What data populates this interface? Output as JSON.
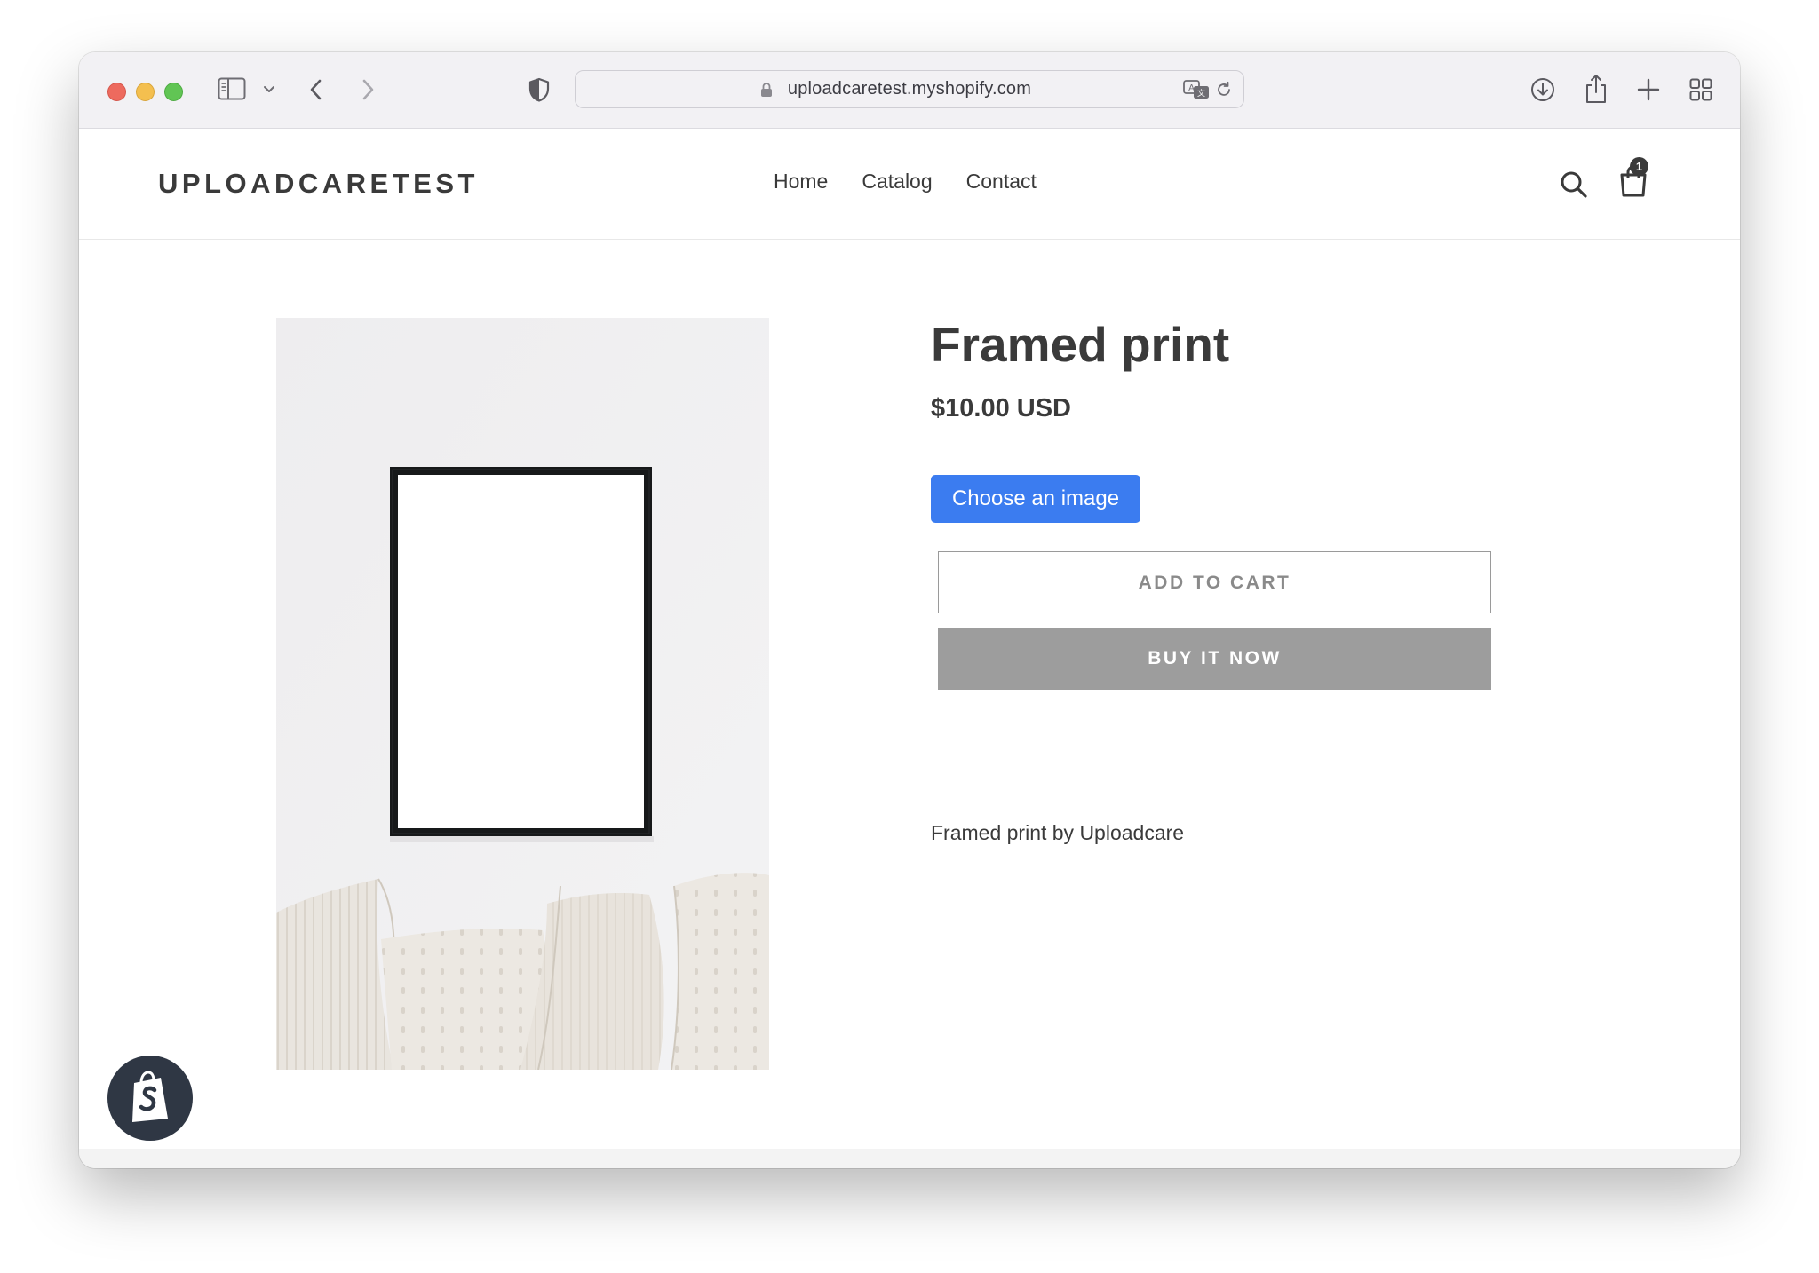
{
  "browser": {
    "url": "uploadcaretest.myshopify.com"
  },
  "store": {
    "name": "UPLOADCARETEST",
    "nav": [
      "Home",
      "Catalog",
      "Contact"
    ],
    "cart_count": "1"
  },
  "product": {
    "title": "Framed print",
    "price": "$10.00 USD",
    "choose_image_label": "Choose an image",
    "add_to_cart_label": "ADD TO CART",
    "buy_now_label": "BUY IT NOW",
    "description": "Framed print by Uploadcare",
    "image_alt": "White framed picture above cushions"
  },
  "colors": {
    "accent_button": "#3b7cf0",
    "text": "#3a3a3a",
    "buy_now_bg": "#9d9d9d",
    "shopify_badge": "#2f3744"
  },
  "icons": [
    "sidebar-icon",
    "chevron-down-icon",
    "back-icon",
    "forward-icon",
    "shield-icon",
    "lock-icon",
    "translate-icon",
    "reload-icon",
    "download-icon",
    "share-icon",
    "new-tab-icon",
    "tab-overview-icon",
    "search-icon",
    "cart-icon",
    "shopify-bag-icon"
  ]
}
